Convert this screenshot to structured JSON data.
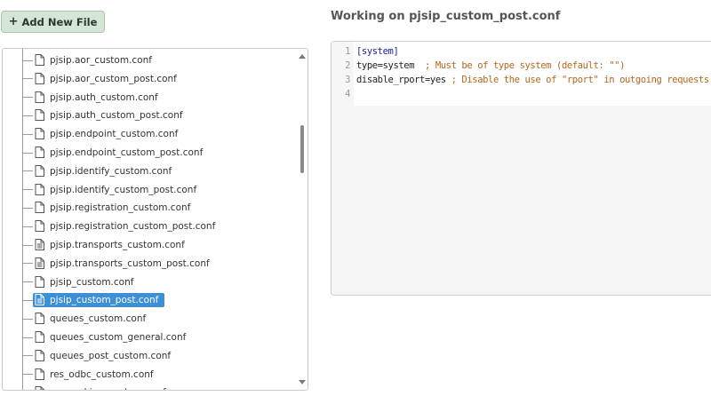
{
  "toolbar": {
    "add_file_label": "Add New File"
  },
  "tree": {
    "items": [
      {
        "label": "pjsip.aor_custom.conf",
        "icon": "file-icon",
        "selected": false
      },
      {
        "label": "pjsip.aor_custom_post.conf",
        "icon": "file-icon",
        "selected": false
      },
      {
        "label": "pjsip.auth_custom.conf",
        "icon": "file-icon",
        "selected": false
      },
      {
        "label": "pjsip.auth_custom_post.conf",
        "icon": "file-icon",
        "selected": false
      },
      {
        "label": "pjsip.endpoint_custom.conf",
        "icon": "file-icon",
        "selected": false
      },
      {
        "label": "pjsip.endpoint_custom_post.conf",
        "icon": "file-icon",
        "selected": false
      },
      {
        "label": "pjsip.identify_custom.conf",
        "icon": "file-icon",
        "selected": false
      },
      {
        "label": "pjsip.identify_custom_post.conf",
        "icon": "file-icon",
        "selected": false
      },
      {
        "label": "pjsip.registration_custom.conf",
        "icon": "file-icon",
        "selected": false
      },
      {
        "label": "pjsip.registration_custom_post.conf",
        "icon": "file-icon",
        "selected": false
      },
      {
        "label": "pjsip.transports_custom.conf",
        "icon": "file-text-icon",
        "selected": false
      },
      {
        "label": "pjsip.transports_custom_post.conf",
        "icon": "file-text-icon",
        "selected": false
      },
      {
        "label": "pjsip_custom.conf",
        "icon": "file-icon",
        "selected": false
      },
      {
        "label": "pjsip_custom_post.conf",
        "icon": "file-text-icon",
        "selected": true
      },
      {
        "label": "queues_custom.conf",
        "icon": "file-icon",
        "selected": false
      },
      {
        "label": "queues_custom_general.conf",
        "icon": "file-icon",
        "selected": false
      },
      {
        "label": "queues_post_custom.conf",
        "icon": "file-icon",
        "selected": false
      },
      {
        "label": "res_odbc_custom.conf",
        "icon": "file-icon",
        "selected": false
      },
      {
        "label": "res_parking_custom.conf",
        "icon": "file-icon",
        "selected": false
      }
    ]
  },
  "editor": {
    "title": "Working on pjsip_custom_post.conf",
    "lines": [
      {
        "num": "1",
        "tokens": [
          {
            "t": "[system]",
            "c": "section"
          }
        ]
      },
      {
        "num": "2",
        "tokens": [
          {
            "t": "type=system  ",
            "c": "key"
          },
          {
            "t": "; Must be of type system (default: \"\")",
            "c": "comment"
          }
        ]
      },
      {
        "num": "3",
        "tokens": [
          {
            "t": "disable_rport=yes ",
            "c": "key"
          },
          {
            "t": "; Disable the use of \"rport\" in outgoing requests.",
            "c": "comment"
          }
        ]
      },
      {
        "num": "4",
        "tokens": []
      }
    ]
  },
  "colors": {
    "selected_bg": "#3d8fd6",
    "comment": "#b4661a",
    "section": "#1a1aa6"
  }
}
